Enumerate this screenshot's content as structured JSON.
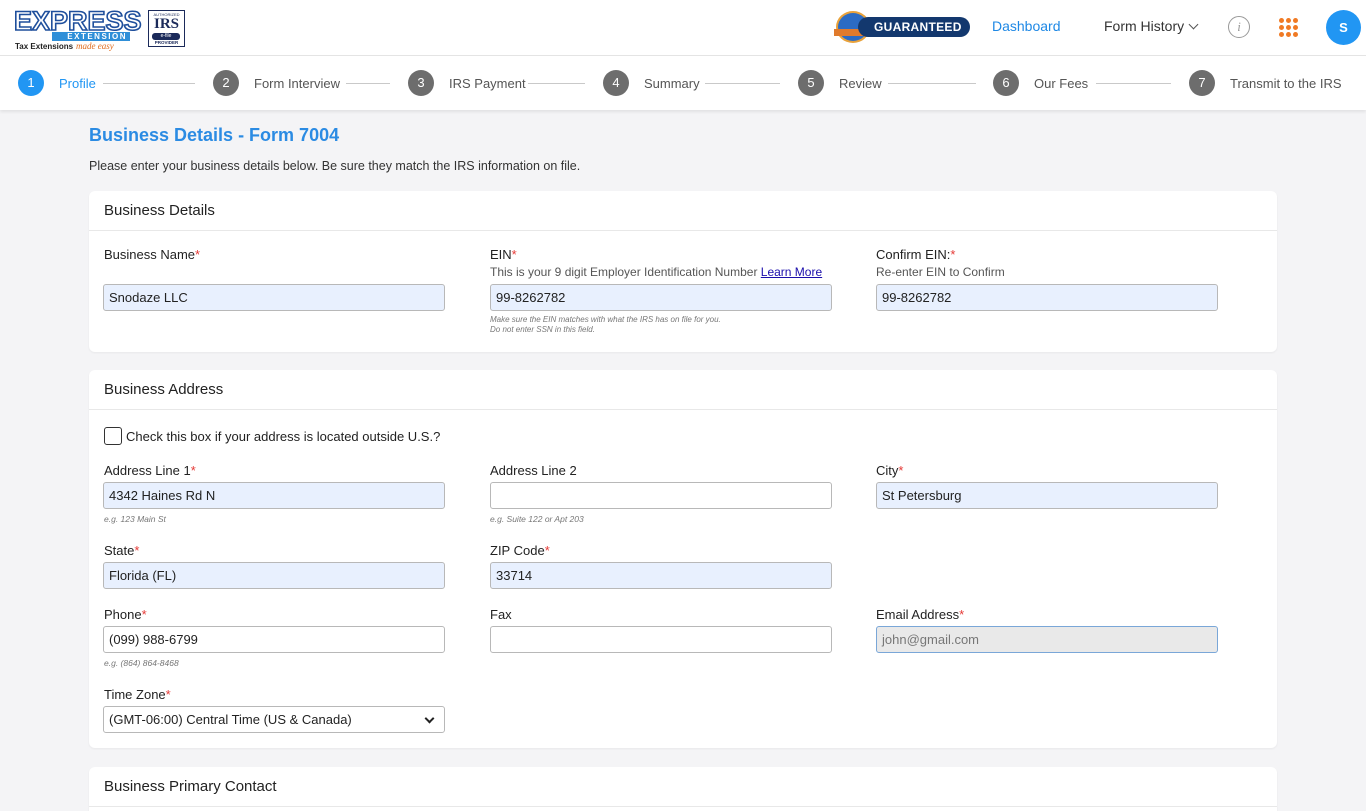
{
  "header": {
    "logo_word": "EXPRESS",
    "logo_bar": "EXTENSION",
    "logo_tag1": "Tax Extensions",
    "logo_tag2": "made easy",
    "irs_line1": "AUTHORIZED",
    "irs_line2": "IRS",
    "irs_line3": "e-file",
    "irs_line4": "PROVIDER",
    "guarantee": "GUARANTEED",
    "dashboard": "Dashboard",
    "form_history": "Form History",
    "info_glyph": "i",
    "avatar_initial": "S"
  },
  "steps": [
    {
      "num": "1",
      "label": "Profile"
    },
    {
      "num": "2",
      "label": "Form Interview"
    },
    {
      "num": "3",
      "label": "IRS Payment"
    },
    {
      "num": "4",
      "label": "Summary"
    },
    {
      "num": "5",
      "label": "Review"
    },
    {
      "num": "6",
      "label": "Our Fees"
    },
    {
      "num": "7",
      "label": "Transmit to the IRS"
    }
  ],
  "page": {
    "title": "Business Details - Form 7004",
    "subtitle": "Please enter your business details below. Be sure they match the IRS information on file."
  },
  "business_details": {
    "heading": "Business Details",
    "name_label": "Business Name",
    "name_value": "Snodaze LLC",
    "ein_label": "EIN",
    "ein_hint": "This is your 9 digit Employer Identification Number ",
    "ein_learn_more": "Learn More",
    "ein_value": "99-8262782",
    "ein_note1": "Make sure the EIN matches with what the IRS has on file for you.",
    "ein_note2": "Do not enter SSN in this field.",
    "confirm_label": "Confirm EIN:",
    "confirm_hint": "Re-enter EIN to Confirm",
    "confirm_value": "99-8262782"
  },
  "business_address": {
    "heading": "Business Address",
    "outside_us_label": "Check this box if your address is located outside U.S.?",
    "address1_label": "Address Line 1",
    "address1_value": "4342 Haines Rd N",
    "address1_example": "e.g. 123 Main St",
    "address2_label": "Address Line 2",
    "address2_value": "",
    "address2_example": "e.g. Suite 122 or Apt 203",
    "city_label": "City",
    "city_value": "St Petersburg",
    "state_label": "State",
    "state_value": "Florida (FL)",
    "zip_label": "ZIP Code",
    "zip_value": "33714",
    "phone_label": "Phone",
    "phone_value": "(099) 988-6799",
    "phone_example": "e.g. (864) 864-8468",
    "fax_label": "Fax",
    "fax_value": "",
    "email_label": "Email Address",
    "email_value": "john@gmail.com",
    "timezone_label": "Time Zone",
    "timezone_value": "(GMT-06:00) Central Time (US & Canada)"
  },
  "primary_contact": {
    "heading": "Business Primary Contact"
  },
  "required_mark": "*",
  "colors": {
    "accent": "#2196f3",
    "title": "#2b8be3",
    "required": "#e53935",
    "apps_icon": "#f07a24",
    "guarantee_pill": "#13386e"
  }
}
